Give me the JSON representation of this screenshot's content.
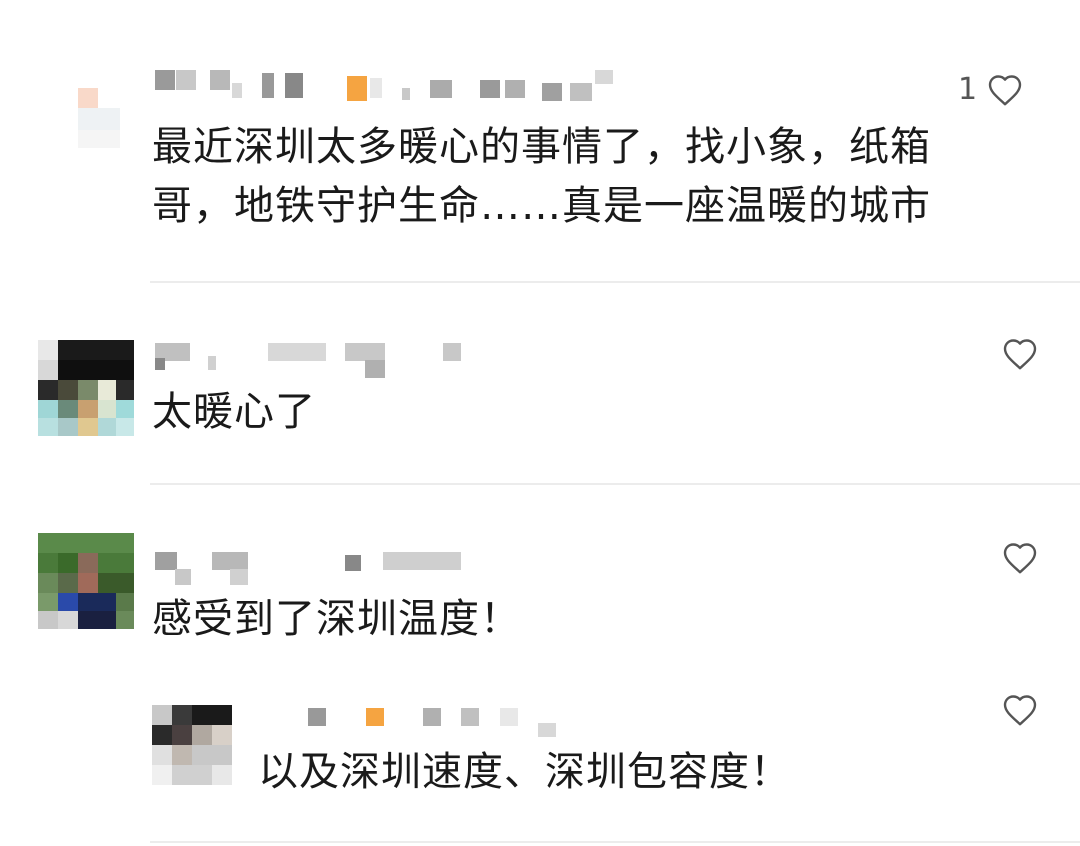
{
  "comments": [
    {
      "text_lines": [
        "最近深圳太多暖心的事情了，找小象，纸箱",
        "哥，地铁守护生命……真是一座温暖的城市"
      ],
      "like_count": "1",
      "like_icon": "heart-outline-icon"
    },
    {
      "text_lines": [
        "太暖心了"
      ],
      "like_count": "",
      "like_icon": "heart-outline-icon"
    },
    {
      "text_lines": [
        "感受到了深圳温度！"
      ],
      "like_count": "",
      "like_icon": "heart-outline-icon",
      "replies": [
        {
          "text_lines": [
            "以及深圳速度、深圳包容度！"
          ],
          "like_count": "",
          "like_icon": "heart-outline-icon"
        }
      ]
    }
  ],
  "colors": {
    "text": "#1a1a1a",
    "icon": "#555555",
    "divider": "#ececec",
    "accent_orange": "#f5a441"
  }
}
